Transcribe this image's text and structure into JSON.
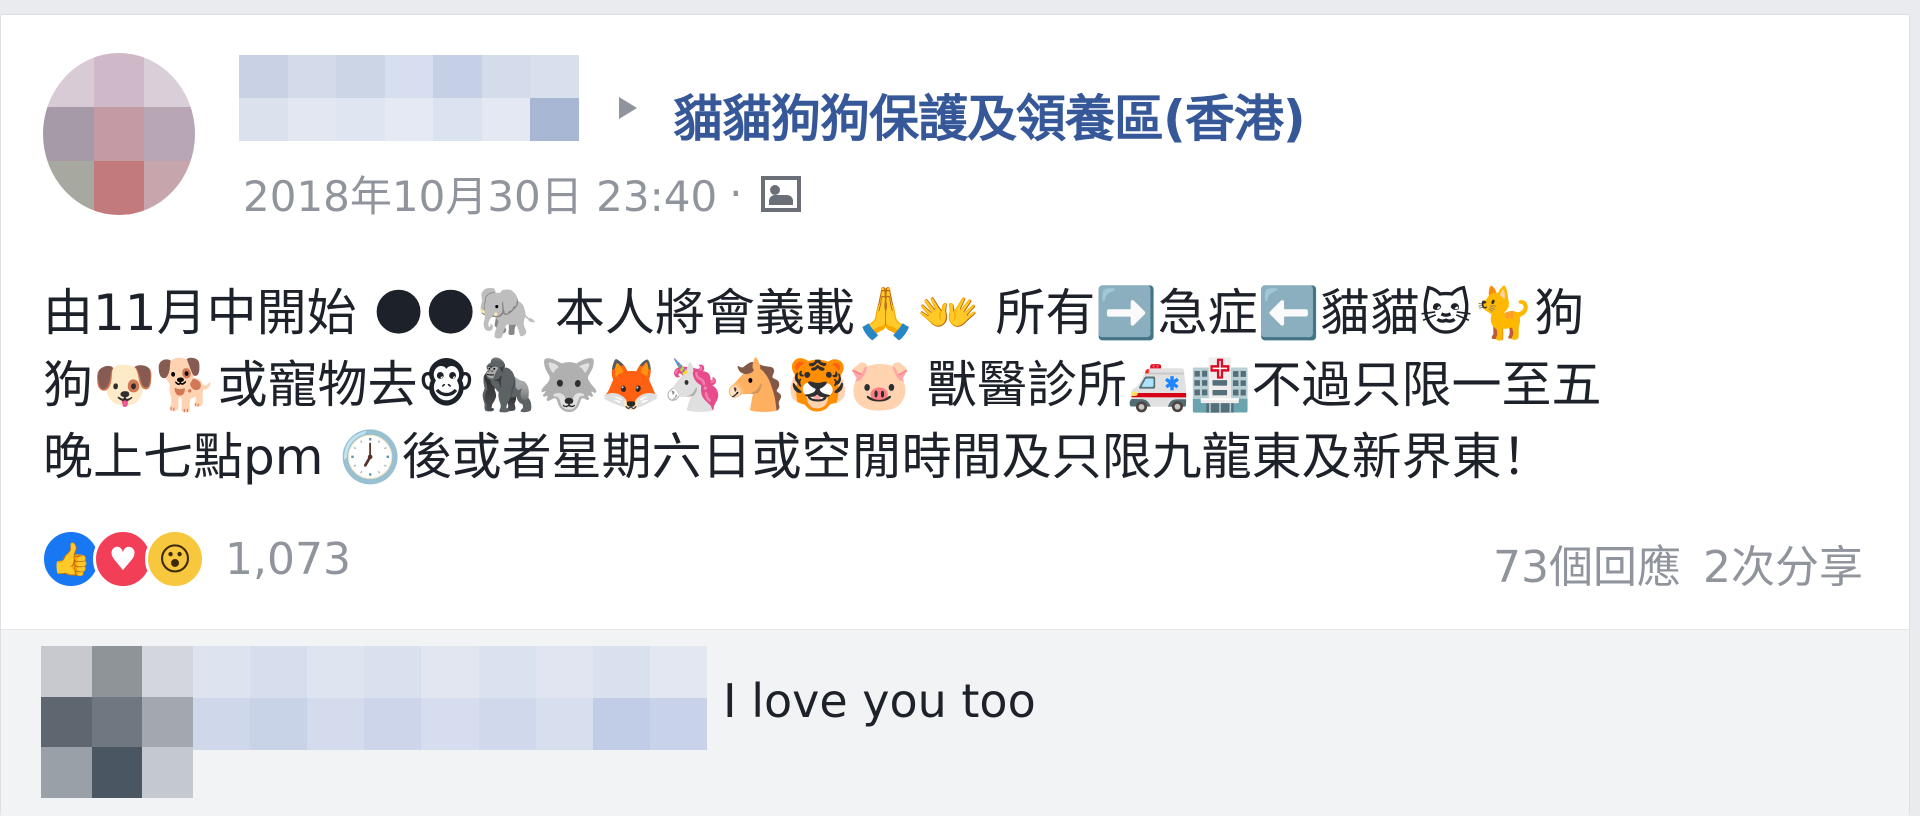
{
  "post": {
    "group_name": "貓貓狗狗保護及領養區(香港)",
    "timestamp": "2018年10月30日 23:40",
    "separator": "·",
    "privacy_icon": "group-members-icon",
    "text_lines": [
      "由11月中開始 🌑🌑🐘 本人將會義載🙏👐 所有➡️急症⬅️貓貓🐱🐈狗",
      "狗🐶🐕或寵物去🐵🦍🐺🦊🦄🐴🐯🐷 獸醫診所🚑🏥不過只限一至五",
      "晚上七點pm 🕖後或者星期六日或空閒時間及只限九龍東及新界東！"
    ]
  },
  "reactions": {
    "like_icon": "👍",
    "love_icon": "♥",
    "wow_icon": "😮",
    "count": "1,073"
  },
  "stats": {
    "comments": "73個回應",
    "shares": "2次分享"
  },
  "comment": {
    "text": "I love you too"
  },
  "colors": {
    "link": "#365899",
    "meta": "#90949c",
    "background": "#e9ebee",
    "comment_bg": "#f2f3f5"
  }
}
